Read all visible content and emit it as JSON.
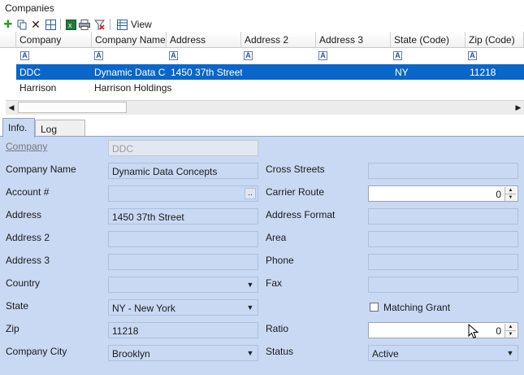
{
  "window": {
    "title": "Companies"
  },
  "toolbar": {
    "view_label": "View"
  },
  "grid": {
    "columns": [
      "Company",
      "Company Name",
      "Address",
      "Address 2",
      "Address 3",
      "State (Code)",
      "Zip (Code)"
    ],
    "filter_glyph": "A",
    "rows": [
      {
        "company": "DDC",
        "company_name": "Dynamic Data Co",
        "address": "1450 37th Street",
        "address2": "",
        "address3": "",
        "state": "NY",
        "zip": "11218",
        "selected": true
      },
      {
        "company": "Harrison",
        "company_name": "Harrison Holdings",
        "address": "",
        "address2": "",
        "address3": "",
        "state": "",
        "zip": "",
        "selected": false
      }
    ]
  },
  "tabs": [
    {
      "label": "Info.",
      "active": true
    },
    {
      "label": "Log Fields",
      "active": false
    }
  ],
  "form": {
    "company": {
      "label": "Company",
      "value": "DDC"
    },
    "company_name": {
      "label": "Company Name",
      "value": "Dynamic Data Concepts"
    },
    "account": {
      "label": "Account #",
      "value": "",
      "button": ".."
    },
    "address": {
      "label": "Address",
      "value": "1450 37th Street"
    },
    "address2": {
      "label": "Address 2",
      "value": ""
    },
    "address3": {
      "label": "Address 3",
      "value": ""
    },
    "country": {
      "label": "Country",
      "value": ""
    },
    "state": {
      "label": "State",
      "value": "NY - New York"
    },
    "zip": {
      "label": "Zip",
      "value": "11218"
    },
    "company_city": {
      "label": "Company City",
      "value": "Brooklyn"
    },
    "cross_streets": {
      "label": "Cross Streets",
      "value": ""
    },
    "carrier_route": {
      "label": "Carrier Route",
      "value": "0"
    },
    "address_format": {
      "label": "Address Format",
      "value": ""
    },
    "area": {
      "label": "Area",
      "value": ""
    },
    "phone": {
      "label": "Phone",
      "value": ""
    },
    "fax": {
      "label": "Fax",
      "value": ""
    },
    "matching_grant": {
      "label": "Matching Grant",
      "checked": false
    },
    "ratio": {
      "label": "Ratio",
      "value": "0"
    },
    "status": {
      "label": "Status",
      "value": "Active"
    }
  },
  "colors": {
    "selection": "#0a66c8",
    "panel": "#c9d9f3",
    "accent": "#2b4f91"
  },
  "icons": [
    "add-icon",
    "copy-icon",
    "delete-icon",
    "grid-layout-icon",
    "excel-icon",
    "print-icon",
    "filter-clear-icon",
    "view-icon"
  ]
}
